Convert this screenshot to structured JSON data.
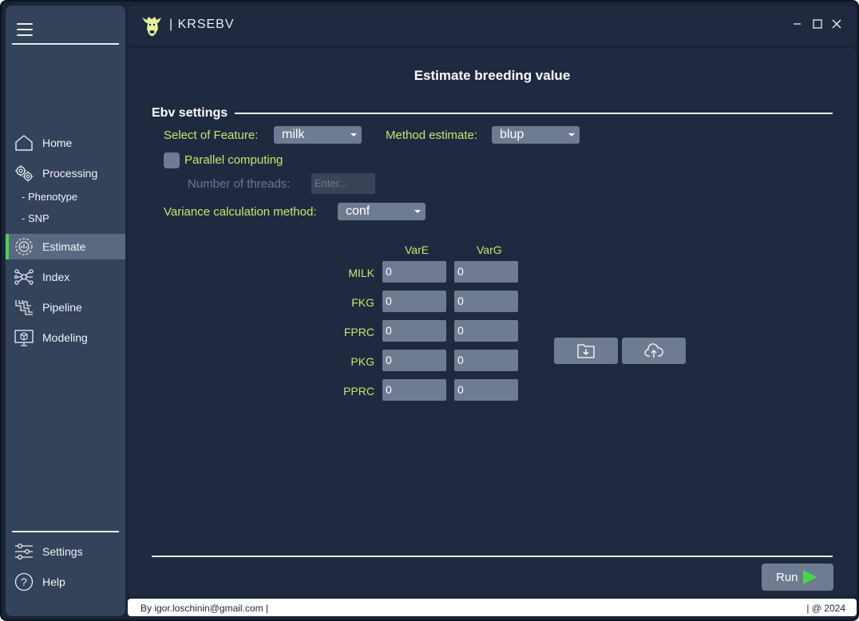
{
  "app": {
    "title": "| KRSEBV"
  },
  "sidebar": {
    "items": [
      {
        "label": "Home",
        "icon": "home-icon"
      },
      {
        "label": "Processing",
        "icon": "gears-icon"
      },
      {
        "label": "Estimate",
        "icon": "estimate-icon",
        "active": true
      },
      {
        "label": "Index",
        "icon": "network-icon"
      },
      {
        "label": "Pipeline",
        "icon": "pipeline-icon"
      },
      {
        "label": "Modeling",
        "icon": "monitor-cube-icon"
      }
    ],
    "subitems": [
      "- Phenotype",
      "- SNP"
    ],
    "bottom": [
      {
        "label": "Settings",
        "icon": "sliders-icon"
      },
      {
        "label": "Help",
        "icon": "help-icon"
      }
    ]
  },
  "main": {
    "title": "Estimate breeding value",
    "group_title": "Ebv settings",
    "feature_label": "Select of Feature:",
    "feature_value": "milk",
    "method_label": "Method estimate:",
    "method_value": "blup",
    "parallel_label": "Parallel computing",
    "threads_label": "Number of threads:",
    "threads_placeholder": "Enter...",
    "variance_label": "Variance calculation method:",
    "variance_value": "conf",
    "table": {
      "columns": [
        "VarE",
        "VarG"
      ],
      "rows": [
        {
          "label": "MILK",
          "vare": "0",
          "varg": "0"
        },
        {
          "label": "FKG",
          "vare": "0",
          "varg": "0"
        },
        {
          "label": "FPRC",
          "vare": "0",
          "varg": "0"
        },
        {
          "label": "PKG",
          "vare": "0",
          "varg": "0"
        },
        {
          "label": "PPRC",
          "vare": "0",
          "varg": "0"
        }
      ]
    },
    "run_label": "Run"
  },
  "footer": {
    "left": "By igor.loschinin@gmail.com |",
    "right": "| @ 2024"
  },
  "colors": {
    "accent_green": "#47d64a",
    "label_yellow_green": "#c8e56c",
    "panel_bg": "#1f2a40",
    "sidebar_bg": "#34425a"
  }
}
